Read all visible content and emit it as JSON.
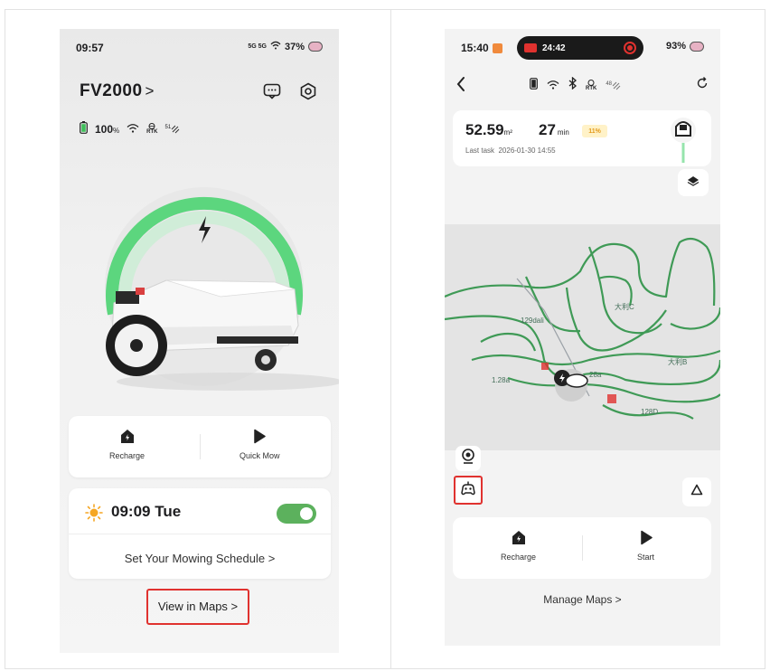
{
  "left_screen": {
    "status": {
      "time": "09:57",
      "signal": "5G 5G",
      "battery": "37%"
    },
    "device_name": "FV2000",
    "title_chevron": ">",
    "stats": {
      "battery_value": "100",
      "battery_unit": "%",
      "rtk_label": "RTK",
      "sat_count": "51"
    },
    "actions": [
      {
        "label": "Recharge",
        "icon": "home-charge-icon"
      },
      {
        "label": "Quick Mow",
        "icon": "play-icon"
      }
    ],
    "schedule": {
      "time": "09:09 Tue",
      "enabled": true,
      "link": "Set Your Mowing Schedule >"
    },
    "view_maps": "View in Maps >",
    "accent": "#5cd67e",
    "highlight": "#e0322f"
  },
  "right_screen": {
    "status": {
      "time": "15:40",
      "recording_time": "24:42",
      "battery": "93%"
    },
    "nav": {
      "rtk_label": "RTK",
      "sat_count": "48"
    },
    "task": {
      "area": "52.59",
      "area_unit": "m²",
      "minutes": "27",
      "minutes_unit": "min",
      "percent": "11%",
      "last_task_label": "Last task",
      "last_task_time": "2026-01-30 14:55"
    },
    "map_labels": [
      "大利C",
      "129dali",
      "1.28a",
      "28a",
      "大利B",
      "128D"
    ],
    "actions": [
      {
        "label": "Recharge",
        "icon": "home-charge-icon"
      },
      {
        "label": "Start",
        "icon": "play-icon"
      }
    ],
    "manage_maps": "Manage Maps >",
    "path_color": "#3f9a56"
  }
}
